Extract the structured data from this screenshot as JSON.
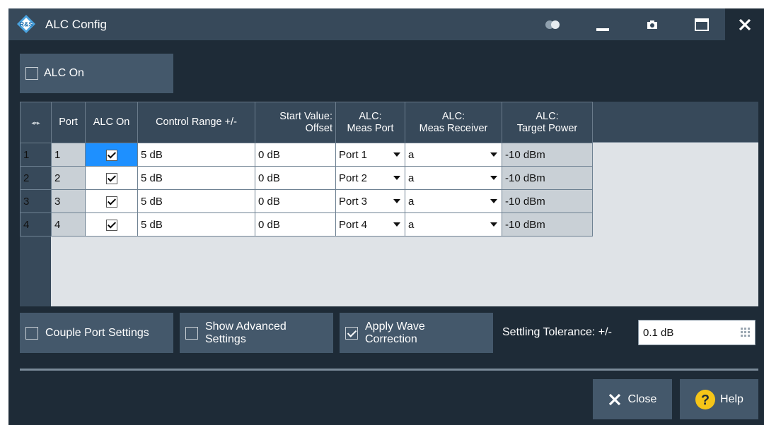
{
  "window": {
    "title": "ALC Config",
    "buttons": [
      "toggle",
      "minimize",
      "screenshot",
      "maximize",
      "close"
    ]
  },
  "top": {
    "alc_on_label": "ALC On",
    "alc_on_checked": false
  },
  "table": {
    "headers": {
      "row_handle": "◂▪▸",
      "port": "Port",
      "alc_on": "ALC On",
      "control_range": "Control Range +/-",
      "start_value_1": "Start Value:",
      "start_value_2": "Offset",
      "meas_port_1": "ALC:",
      "meas_port_2": "Meas Port",
      "meas_receiver_1": "ALC:",
      "meas_receiver_2": "Meas Receiver",
      "target_power_1": "ALC:",
      "target_power_2": "Target Power"
    },
    "rows": [
      {
        "num": "1",
        "port": "1",
        "alc_on": true,
        "control_range": "5 dB",
        "start_value": "0 dB",
        "meas_port": "Port 1",
        "meas_receiver": "a",
        "target_power": "-10 dBm"
      },
      {
        "num": "2",
        "port": "2",
        "alc_on": true,
        "control_range": "5 dB",
        "start_value": "0 dB",
        "meas_port": "Port 2",
        "meas_receiver": "a",
        "target_power": "-10 dBm"
      },
      {
        "num": "3",
        "port": "3",
        "alc_on": true,
        "control_range": "5 dB",
        "start_value": "0 dB",
        "meas_port": "Port 3",
        "meas_receiver": "a",
        "target_power": "-10 dBm"
      },
      {
        "num": "4",
        "port": "4",
        "alc_on": true,
        "control_range": "5 dB",
        "start_value": "0 dB",
        "meas_port": "Port 4",
        "meas_receiver": "a",
        "target_power": "-10 dBm"
      }
    ]
  },
  "options": {
    "couple": {
      "label": "Couple Port Settings",
      "checked": false
    },
    "advanced": {
      "label_1": "Show Advanced",
      "label_2": "Settings",
      "checked": false
    },
    "wave": {
      "label_1": "Apply Wave",
      "label_2": "Correction",
      "checked": true
    }
  },
  "settling": {
    "label": "Settling Tolerance: +/-",
    "value": "0.1 dB"
  },
  "footer": {
    "close_label": "Close",
    "help_label": "Help"
  },
  "colors": {
    "title_bar": "#37495a",
    "dialog_bg": "#1e2b37",
    "button_bg": "#44586b",
    "selection": "#1e90ff",
    "help_yellow": "#f5c518"
  }
}
